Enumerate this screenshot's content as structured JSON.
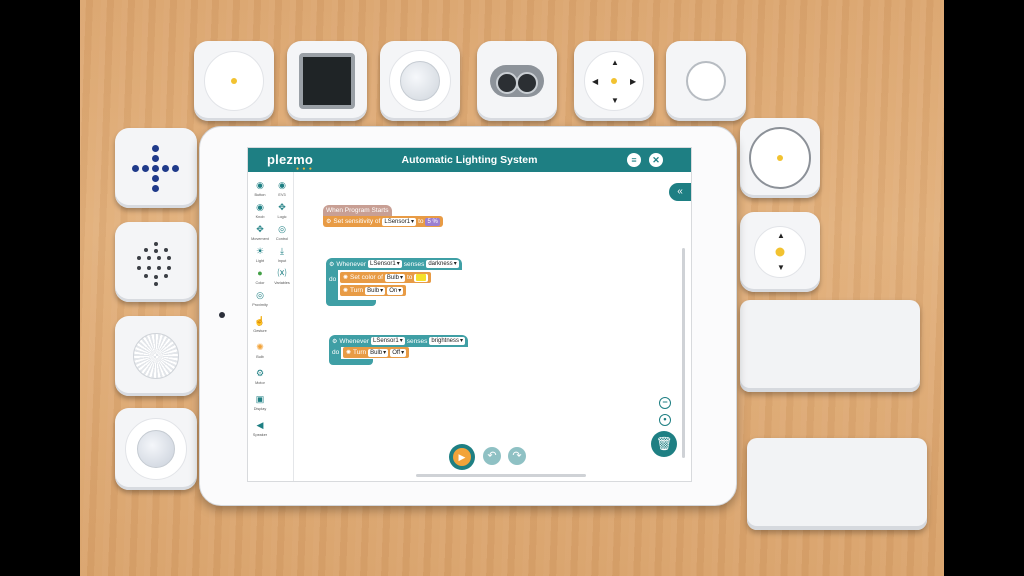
{
  "app": {
    "logo": "plezmo",
    "logo_dots": "● ● ●",
    "title": "Automatic Lighting System",
    "menu_icon": "menu-icon",
    "close_icon": "close-icon",
    "collapse_icon": "double-chevron-left-icon"
  },
  "palette": [
    {
      "label": "Button",
      "icon": "button-icon",
      "glyph": "◉",
      "color": "#1e7f83"
    },
    {
      "label": "EV3",
      "icon": "ev3-icon",
      "glyph": "◉",
      "color": "#1e7f83"
    },
    {
      "label": "Knob",
      "icon": "knob-icon",
      "glyph": "◉",
      "color": "#1e7f83"
    },
    {
      "label": "Logic",
      "icon": "logic-icon",
      "glyph": "✥",
      "color": "#1e7f83"
    },
    {
      "label": "Movement",
      "icon": "movement-icon",
      "glyph": "✥",
      "color": "#1e7f83"
    },
    {
      "label": "Control",
      "icon": "control-icon",
      "glyph": "◎",
      "color": "#1e7f83"
    },
    {
      "label": "Light",
      "icon": "light-icon",
      "glyph": "☀",
      "color": "#1e7f83"
    },
    {
      "label": "Input",
      "icon": "input-icon",
      "glyph": "⤓",
      "color": "#1e7f83"
    },
    {
      "label": "Color",
      "icon": "color-icon",
      "glyph": "●",
      "color": "#43a047"
    },
    {
      "label": "Variables",
      "icon": "variables-icon",
      "glyph": "⒳",
      "color": "#1e7f83"
    },
    {
      "label": "Proximity",
      "icon": "proximity-icon",
      "glyph": "◎",
      "color": "#1e7f83"
    },
    {
      "label": "Gesture",
      "icon": "gesture-icon",
      "glyph": "☝",
      "color": "#1e7f83"
    },
    {
      "label": "Bulb",
      "icon": "bulb-icon",
      "glyph": "✺",
      "color": "#f2a33a"
    },
    {
      "label": "Motor",
      "icon": "motor-icon",
      "glyph": "⚙",
      "color": "#1e7f83"
    },
    {
      "label": "Display",
      "icon": "display-icon",
      "glyph": "▣",
      "color": "#1e7f83"
    },
    {
      "label": "Speaker",
      "icon": "speaker-icon",
      "glyph": "◀",
      "color": "#1e7f83"
    }
  ],
  "blocks": {
    "start": {
      "hat": "When Program Starts",
      "set_sensitivity": "Set sensitivity of",
      "sensor": "LSensor1",
      "to": "to",
      "value": "5",
      "unit": "%"
    },
    "darkness": {
      "whenever": "Whenever",
      "sensor": "LSensor1",
      "senses": "senses",
      "condition": "darkness",
      "do": "do",
      "set_color": "Set color of",
      "bulb": "Bulb",
      "to": "to",
      "color": "#f5e02a",
      "turn": "Turn",
      "bulb2": "Bulb",
      "state": "On"
    },
    "brightness": {
      "whenever": "Whenever",
      "sensor": "LSensor1",
      "senses": "senses",
      "condition": "brightness",
      "do": "do",
      "turn": "Turn",
      "bulb": "Bulb",
      "state": "Off"
    }
  },
  "controls": {
    "play_icon": "play-icon",
    "undo_icon": "undo-icon",
    "redo_icon": "redo-icon",
    "zoom_out_icon": "zoom-out-icon",
    "zoom_in_icon": "zoom-in-icon",
    "trash_icon": "trash-icon"
  },
  "colors": {
    "accent": "#1e7f83",
    "hat_block": "#c89f94",
    "action_block": "#e89b45",
    "event_block": "#3f9fa5",
    "number_field": "#9b7fd1"
  }
}
